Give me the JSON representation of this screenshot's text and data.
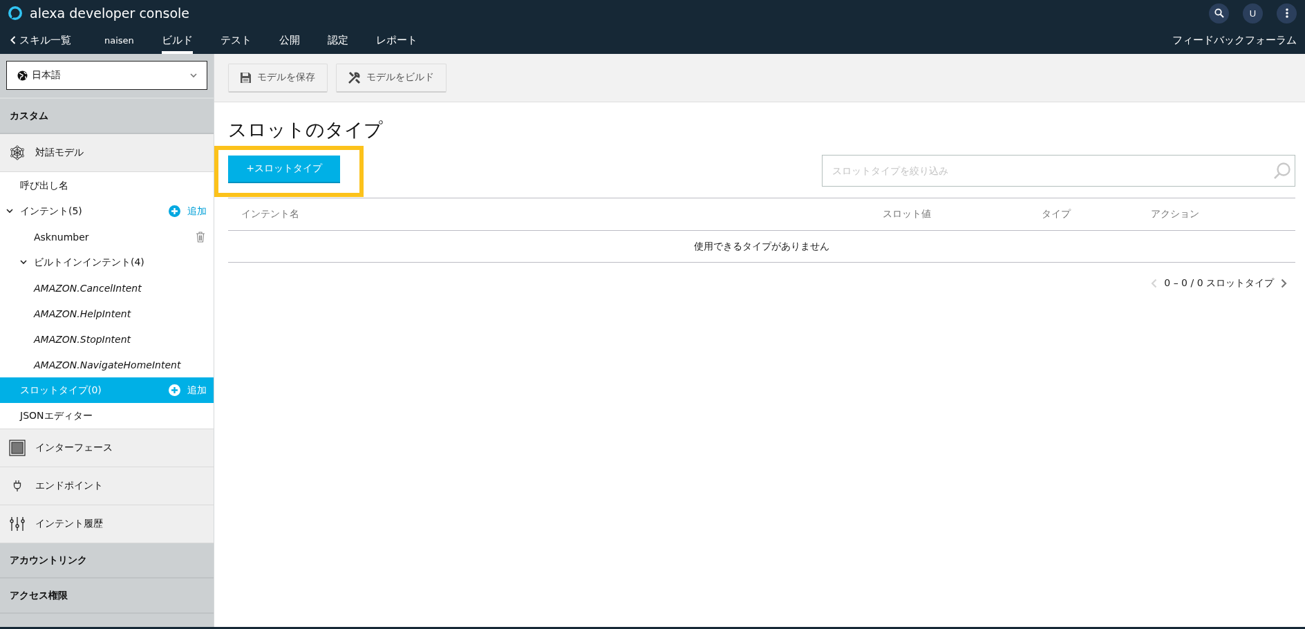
{
  "header": {
    "logo_text": "alexa developer console",
    "back_link": "スキル一覧",
    "skill_name": "naisen",
    "tabs": [
      {
        "label": "ビルド",
        "selected": true
      },
      {
        "label": "テスト",
        "selected": false
      },
      {
        "label": "公開",
        "selected": false
      },
      {
        "label": "認定",
        "selected": false
      },
      {
        "label": "レポート",
        "selected": false
      }
    ],
    "avatar": "U",
    "feedback_link": "フィードバックフォーラム"
  },
  "sidebar": {
    "language": "日本語",
    "sections": [
      {
        "kind": "header",
        "label": "カスタム"
      },
      {
        "kind": "group",
        "label": "対話モデル",
        "children": [
          {
            "label": "呼び出し名",
            "selected": false
          },
          {
            "label": "インテント(5)",
            "selected": false,
            "expanded": true,
            "action": "追加",
            "children": [
              {
                "label": "Asknumber",
                "kind": "custom",
                "selected": false
              },
              {
                "label": "ビルトインインテント(4)",
                "kind": "folder",
                "selected": false,
                "expanded": true,
                "children": [
                  {
                    "label": "AMAZON.CancelIntent",
                    "kind": "builtin",
                    "selected": false
                  },
                  {
                    "label": "AMAZON.HelpIntent",
                    "kind": "builtin",
                    "selected": false
                  },
                  {
                    "label": "AMAZON.StopIntent",
                    "kind": "builtin",
                    "selected": false
                  },
                  {
                    "label": "AMAZON.NavigateHomeIntent",
                    "kind": "builtin",
                    "selected": false
                  }
                ]
              }
            ]
          },
          {
            "label": "スロットタイプ(0)",
            "selected": true,
            "action": "追加"
          },
          {
            "label": "JSONエディター",
            "selected": false
          }
        ]
      },
      {
        "kind": "group",
        "label": "インターフェース"
      },
      {
        "kind": "group",
        "label": "エンドポイント"
      },
      {
        "kind": "group",
        "label": "インテント履歴"
      },
      {
        "kind": "header",
        "label": "アカウントリンク"
      },
      {
        "kind": "header",
        "label": "アクセス権限"
      }
    ]
  },
  "toolbar": {
    "buttons": [
      "モデルを保存",
      "モデルをビルド"
    ]
  },
  "page": {
    "title": "スロットのタイプ",
    "new_button": {
      "label": "+スロットタイプ",
      "highlighted": true
    },
    "filter": {
      "placeholder": "スロットタイプを絞り込み"
    },
    "table": {
      "columns": [
        "インテント名",
        "スロット値",
        "タイプ",
        "アクション"
      ],
      "empty_message": "使用できるタイプがありません"
    },
    "pagination": {
      "text": "0 – 0 / 0 スロットタイプ",
      "prev_disabled": true,
      "next_disabled": false
    }
  }
}
